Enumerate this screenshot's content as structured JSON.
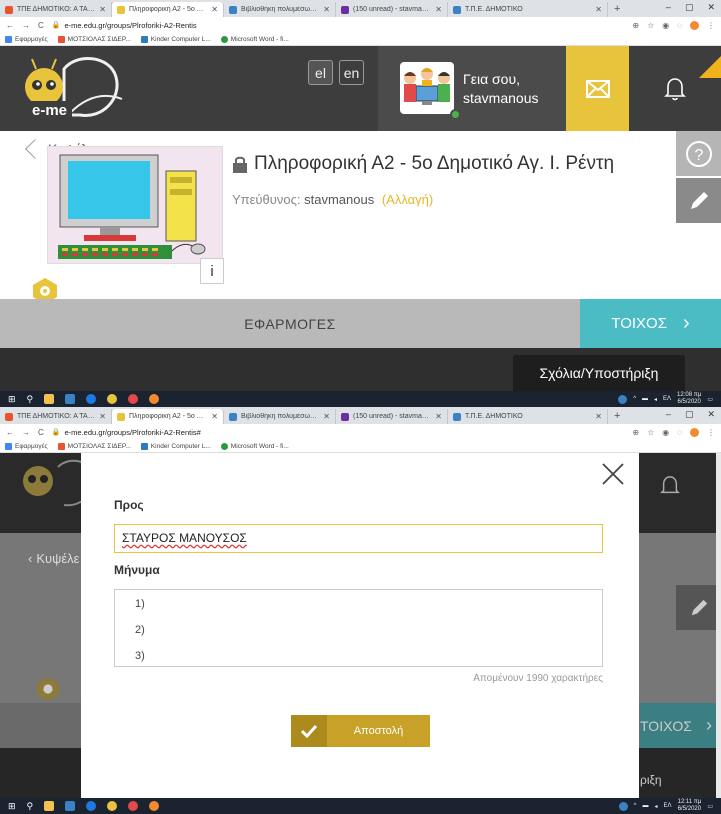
{
  "screen1": {
    "tabs": [
      {
        "label": "ΤΠΕ ΔΗΜΟΤΙΚΟ: Α ΤΑΞΗ",
        "color": "#e8542f"
      },
      {
        "label": "Πληροφορική Α2 - 5ο Δημοτικό",
        "color": "#e8c33c"
      },
      {
        "label": "Βιβλιοθήκη πολυμέσων - Τ.Π.Ε. /",
        "color": "#3b82c4"
      },
      {
        "label": "(150 unread) - stavmanus@yahoo",
        "color": "#6a2ea0"
      },
      {
        "label": "Τ.Π.Ε. ΔΗΜΟΤΙΚΟ",
        "color": "#3b82c4"
      }
    ],
    "url": "e-me.edu.gr/groups/Plroforiki-A2-Rentis"
  },
  "screen2": {
    "tabs": [
      {
        "label": "ΤΠΕ ΔΗΜΟΤΙΚΟ: Α ΤΑΞΗ",
        "color": "#e8542f"
      },
      {
        "label": "Πληροφορική Α2 - 5ο Δημοτικό",
        "color": "#e8c33c"
      },
      {
        "label": "Βιβλιοθήκη πολυμέσων - Τ.Π.Ε. /",
        "color": "#3b82c4"
      },
      {
        "label": "(150 unread) - stavmanus@yahoo",
        "color": "#6a2ea0"
      },
      {
        "label": "Τ.Π.Ε. ΔΗΜΟΤΙΚΟ",
        "color": "#3b82c4"
      }
    ],
    "url": "e-me.edu.gr/groups/Plroforiki-A2-Rentis#"
  },
  "bookmarks": [
    {
      "label": "Εφαρμογές",
      "color": "#4285f4"
    },
    {
      "label": "ΜΟΤΣΙΟΛΑΣ ΣΙΔΕΡ...",
      "color": "#e8542f"
    },
    {
      "label": "Kinder Computer L...",
      "color": "#2a7bbf"
    },
    {
      "label": "Microsoft Word - fi...",
      "color": "#2b9a3f"
    }
  ],
  "header": {
    "logo_text": "e-me",
    "lang_el": "el",
    "lang_en": "en",
    "greeting": "Γεια σου,",
    "username": "stavmanous"
  },
  "group": {
    "back_label": "Κυψέλες",
    "title": "Πληροφορική Α2 - 5ο Δημοτικό Αγ. Ι. Ρέντη",
    "owner_label": "Υπεύθυνος:",
    "owner_name": "stavmanous",
    "change_label": "(Αλλαγή)",
    "info_label": "i"
  },
  "nav": {
    "apps": "ΕΦΑΡΜΟΓΕΣ",
    "wall": "ΤΟΙΧΟΣ",
    "support": "Σχόλια/Υποστήριξη"
  },
  "taskbar": {
    "clock1_time": "12:08 πμ",
    "clock1_date": "6/5/2020",
    "clock2_time": "12:11 πμ",
    "clock2_date": "6/5/2020",
    "lang": "ΕΛ"
  },
  "modal": {
    "to_label": "Προς",
    "to_value": "ΣΤΑΥΡΟΣ ΜΑΝΟΥΣΟΣ",
    "message_label": "Μήνυμα",
    "lines": [
      "1)",
      "2)",
      "3)"
    ],
    "counter": "Απομένουν 1990 χαρακτήρες",
    "send_label": "Αποστολή",
    "bg_wall": "ΤΟΙΧΟΣ",
    "bg_back": "Κυψέλε",
    "bg_tip": "ριξη"
  },
  "colors": {
    "accent": "#e8c33c",
    "teal": "#4cbcc4",
    "header": "#3d3d3d",
    "send": "#c7a128"
  }
}
